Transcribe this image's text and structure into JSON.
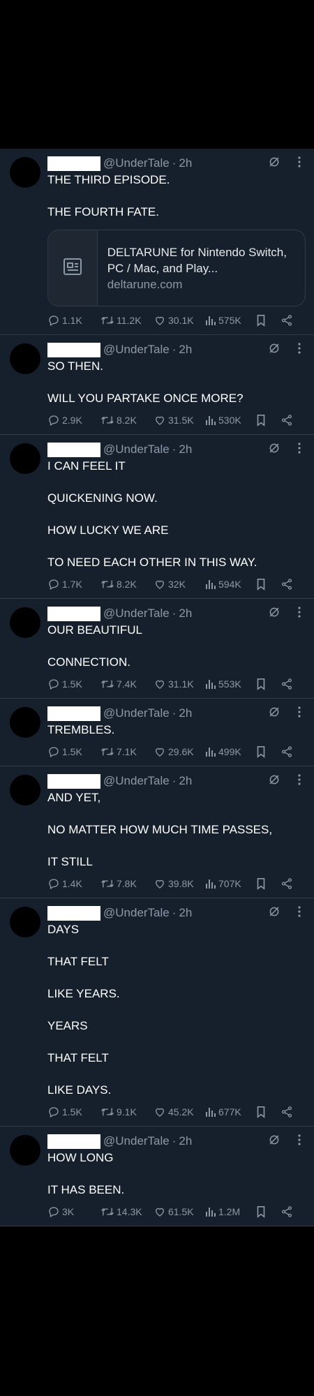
{
  "colors": {
    "background": "#16202c",
    "text": "#ffffff",
    "muted": "#8b98a5",
    "border": "#2f3b47"
  },
  "tweets": [
    {
      "handle": "@UnderTale",
      "time": "2h",
      "paragraphs": [
        "THE THIRD EPISODE.",
        "THE FOURTH FATE."
      ],
      "card": {
        "title": "DELTARUNE for Nintendo Switch, PC / Mac, and Play...",
        "domain": "deltarune.com",
        "icon": "article-icon"
      },
      "replies": "1.1K",
      "retweets": "11.2K",
      "likes": "30.1K",
      "views": "575K"
    },
    {
      "handle": "@UnderTale",
      "time": "2h",
      "paragraphs": [
        "SO THEN.",
        "WILL YOU PARTAKE ONCE MORE?"
      ],
      "replies": "2.9K",
      "retweets": "8.2K",
      "likes": "31.5K",
      "views": "530K"
    },
    {
      "handle": "@UnderTale",
      "time": "2h",
      "paragraphs": [
        "I CAN FEEL IT",
        "QUICKENING NOW.",
        "HOW LUCKY WE ARE",
        "TO NEED EACH OTHER IN THIS WAY."
      ],
      "replies": "1.7K",
      "retweets": "8.2K",
      "likes": "32K",
      "views": "594K"
    },
    {
      "handle": "@UnderTale",
      "time": "2h",
      "paragraphs": [
        "OUR BEAUTIFUL",
        "CONNECTION."
      ],
      "replies": "1.5K",
      "retweets": "7.4K",
      "likes": "31.1K",
      "views": "553K"
    },
    {
      "handle": "@UnderTale",
      "time": "2h",
      "paragraphs": [
        "TREMBLES."
      ],
      "replies": "1.5K",
      "retweets": "7.1K",
      "likes": "29.6K",
      "views": "499K"
    },
    {
      "handle": "@UnderTale",
      "time": "2h",
      "paragraphs": [
        "AND YET,",
        "NO MATTER HOW MUCH TIME PASSES,",
        "IT STILL"
      ],
      "replies": "1.4K",
      "retweets": "7.8K",
      "likes": "39.8K",
      "views": "707K"
    },
    {
      "handle": "@UnderTale",
      "time": "2h",
      "paragraphs": [
        "DAYS",
        "THAT FELT",
        "LIKE YEARS.",
        "YEARS",
        "THAT FELT",
        "LIKE DAYS."
      ],
      "replies": "1.5K",
      "retweets": "9.1K",
      "likes": "45.2K",
      "views": "677K"
    },
    {
      "handle": "@UnderTale",
      "time": "2h",
      "paragraphs": [
        "HOW LONG",
        "IT HAS BEEN."
      ],
      "replies": "3K",
      "retweets": "14.3K",
      "likes": "61.5K",
      "views": "1.2M"
    }
  ]
}
